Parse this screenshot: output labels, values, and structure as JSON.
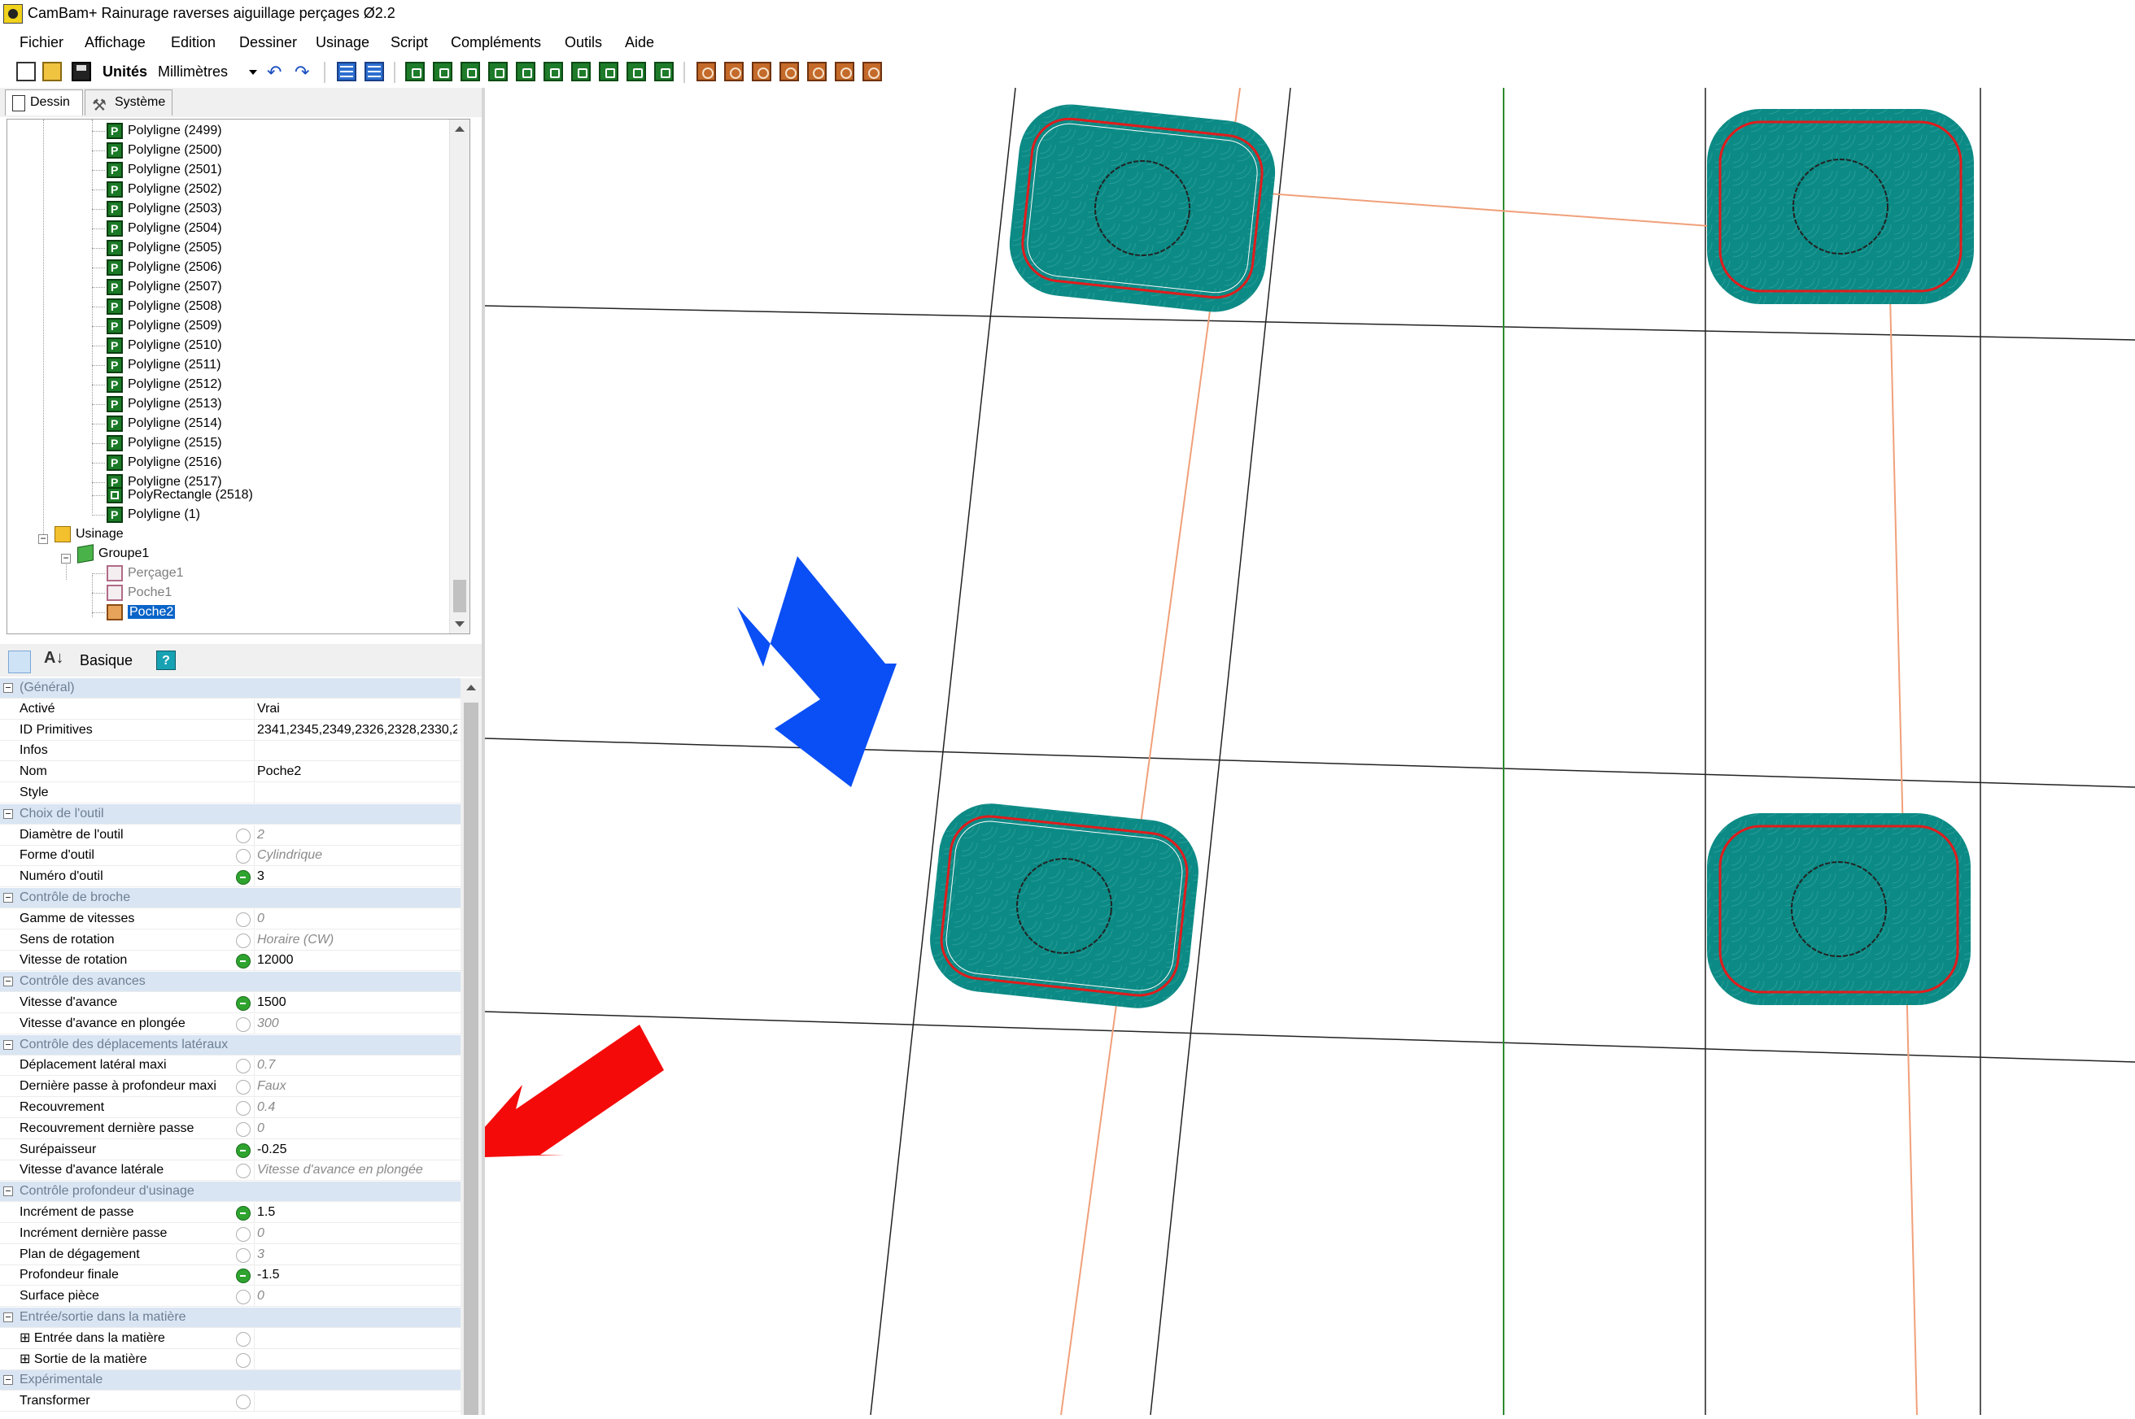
{
  "window": {
    "title": "CamBam+  Rainurage raverses aiguillage  perçages Ø2.2"
  },
  "menu": [
    "Fichier",
    "Affichage",
    "Edition",
    "Dessiner",
    "Usinage",
    "Script",
    "Compléments",
    "Outils",
    "Aide"
  ],
  "toolbar": {
    "units_label": "Unités",
    "units_value": "Millimètres"
  },
  "tabs": {
    "dessin": "Dessin",
    "systeme": "Système"
  },
  "tree": {
    "polylines": [
      "Polyligne (2499)",
      "Polyligne (2500)",
      "Polyligne (2501)",
      "Polyligne (2502)",
      "Polyligne (2503)",
      "Polyligne (2504)",
      "Polyligne (2505)",
      "Polyligne (2506)",
      "Polyligne (2507)",
      "Polyligne (2508)",
      "Polyligne (2509)",
      "Polyligne (2510)",
      "Polyligne (2511)",
      "Polyligne (2512)",
      "Polyligne (2513)",
      "Polyligne (2514)",
      "Polyligne (2515)",
      "Polyligne (2516)",
      "Polyligne (2517)"
    ],
    "polyrect": "PolyRectangle (2518)",
    "polyline1": "Polyligne (1)",
    "usinage": "Usinage",
    "groupe": "Groupe1",
    "ops": [
      "Perçage1",
      "Poche1",
      "Poche2"
    ]
  },
  "prop_toolbar": {
    "mode": "Basique"
  },
  "properties": [
    {
      "type": "cat",
      "name": "(Général)"
    },
    {
      "name": "Activé",
      "value": "Vrai",
      "icon": "none",
      "def": false
    },
    {
      "name": "ID Primitives",
      "value": "2341,2345,2349,2326,2328,2330,2",
      "icon": "none",
      "def": false
    },
    {
      "name": "Infos",
      "value": "",
      "icon": "none",
      "def": false
    },
    {
      "name": "Nom",
      "value": "Poche2",
      "icon": "none",
      "def": false
    },
    {
      "name": "Style",
      "value": "",
      "icon": "none",
      "def": false
    },
    {
      "type": "cat",
      "name": "Choix de l'outil"
    },
    {
      "name": "Diamètre de l'outil",
      "value": "2",
      "icon": "gray",
      "def": true
    },
    {
      "name": "Forme d'outil",
      "value": "Cylindrique",
      "icon": "gray",
      "def": true
    },
    {
      "name": "Numéro d'outil",
      "value": "3",
      "icon": "green",
      "def": false
    },
    {
      "type": "cat",
      "name": "Contrôle de broche"
    },
    {
      "name": "Gamme de vitesses",
      "value": "0",
      "icon": "gray",
      "def": true
    },
    {
      "name": "Sens de rotation",
      "value": "Horaire (CW)",
      "icon": "gray",
      "def": true
    },
    {
      "name": "Vitesse de rotation",
      "value": "12000",
      "icon": "green",
      "def": false
    },
    {
      "type": "cat",
      "name": "Contrôle des avances"
    },
    {
      "name": "Vitesse d'avance",
      "value": "1500",
      "icon": "green",
      "def": false
    },
    {
      "name": "Vitesse d'avance en plongée",
      "value": "300",
      "icon": "gray",
      "def": true
    },
    {
      "type": "cat",
      "name": "Contrôle des déplacements latéraux"
    },
    {
      "name": "Déplacement latéral maxi",
      "value": "0.7",
      "icon": "gray",
      "def": true
    },
    {
      "name": "Dernière passe à profondeur maxi",
      "value": "Faux",
      "icon": "gray",
      "def": true
    },
    {
      "name": "Recouvrement",
      "value": "0.4",
      "icon": "gray",
      "def": true
    },
    {
      "name": "Recouvrement dernière passe",
      "value": "0",
      "icon": "gray",
      "def": true
    },
    {
      "name": "Surépaisseur",
      "value": "-0.25",
      "icon": "green",
      "def": false
    },
    {
      "name": "Vitesse d'avance latérale",
      "value": "Vitesse d'avance en plongée",
      "icon": "gray",
      "def": true
    },
    {
      "type": "cat",
      "name": "Contrôle profondeur d'usinage"
    },
    {
      "name": "Incrément de passe",
      "value": "1.5",
      "icon": "green",
      "def": false
    },
    {
      "name": "Incrément dernière passe",
      "value": "0",
      "icon": "gray",
      "def": true
    },
    {
      "name": "Plan de dégagement",
      "value": "3",
      "icon": "gray",
      "def": true
    },
    {
      "name": "Profondeur finale",
      "value": "-1.5",
      "icon": "green",
      "def": false
    },
    {
      "name": "Surface pièce",
      "value": "0",
      "icon": "gray",
      "def": true
    },
    {
      "type": "cat",
      "name": "Entrée/sortie dans la matière"
    },
    {
      "name": "⊞ Entrée dans la matière",
      "value": "",
      "icon": "gray",
      "def": false
    },
    {
      "name": "⊞ Sortie de la matière",
      "value": "",
      "icon": "gray",
      "def": false
    },
    {
      "type": "cat",
      "name": "Expérimentale"
    },
    {
      "name": "Transformer",
      "value": "",
      "icon": "gray",
      "def": false
    }
  ],
  "colors": {
    "pocket_fill": "#0c8a85",
    "toolpath": "#e11c1c",
    "grid_line": "#222222",
    "guide_line": "#f0a07a",
    "axis_green": "#2c8a2c",
    "annot_blue": "#0a4ef5",
    "annot_red": "#f50a0a",
    "selection": "#0a64c8"
  }
}
